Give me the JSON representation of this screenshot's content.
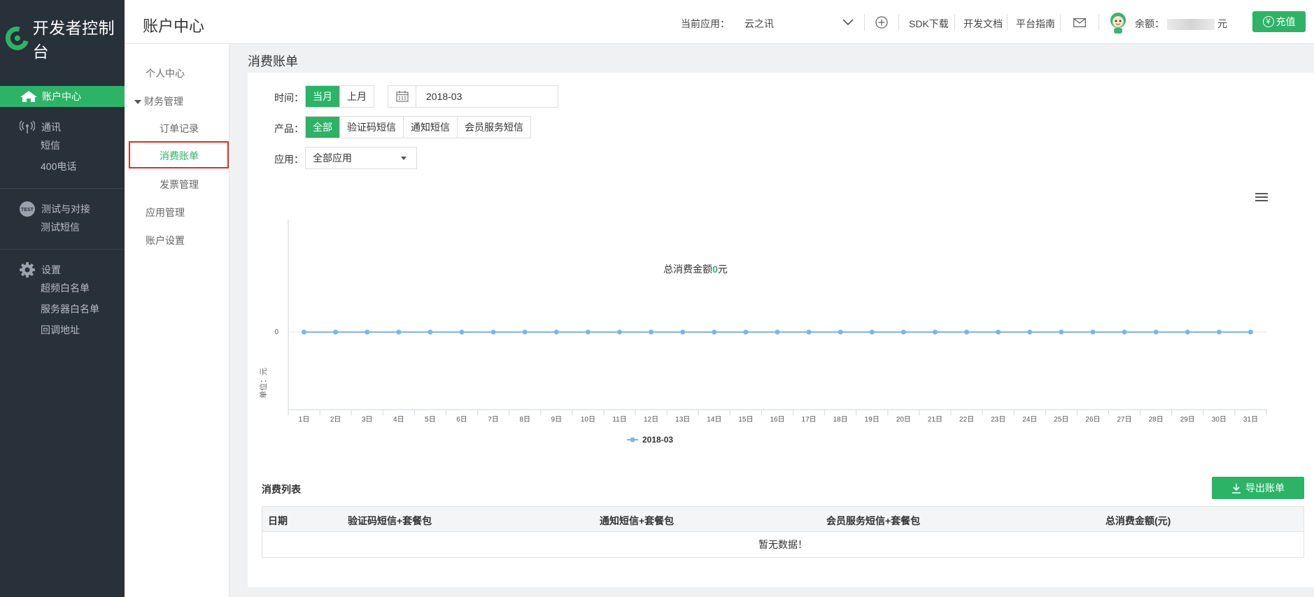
{
  "sidebar": {
    "logo_text": "开发者控制台",
    "active_item": "账户中心",
    "groups": [
      {
        "title": "通讯",
        "icon": "signal-icon",
        "items": [
          "短信",
          "400电话"
        ]
      },
      {
        "title": "测试与对接",
        "icon": "test-icon",
        "items": [
          "测试短信"
        ]
      },
      {
        "title": "设置",
        "icon": "gear-icon",
        "items": [
          "超频白名单",
          "服务器白名单",
          "回调地址"
        ]
      }
    ]
  },
  "topbar": {
    "title": "账户中心",
    "current_app_label": "当前应用：",
    "current_app_value": "云之讯",
    "sdk_download": "SDK下载",
    "dev_docs": "开发文档",
    "platform_guide": "平台指南",
    "balance_label": "余额：",
    "balance_unit": "元",
    "recharge": "充值"
  },
  "submenu": {
    "personal_center": "个人中心",
    "finance": "财务管理",
    "orders": "订单记录",
    "bills": "消费账单",
    "invoices": "发票管理",
    "app_manage": "应用管理",
    "account_settings": "账户设置"
  },
  "content": {
    "section_title": "消费账单",
    "time_label": "时间：",
    "time_options": [
      "当月",
      "上月"
    ],
    "date_value": "2018-03",
    "product_label": "产品：",
    "product_options": [
      "全部",
      "验证码短信",
      "通知短信",
      "会员服务短信"
    ],
    "app_label": "应用：",
    "app_select_value": "全部应用",
    "list_title": "消费列表",
    "export_button": "导出账单",
    "table": {
      "headers": [
        "日期",
        "验证码短信+套餐包",
        "通知短信+套餐包",
        "会员服务短信+套餐包",
        "总消费金额(元)"
      ],
      "empty_text": "暂无数据！"
    }
  },
  "chart_data": {
    "type": "line",
    "title_prefix": "总消费金额",
    "title_value": "0",
    "title_suffix": "元",
    "ylabel": "单位：元",
    "y_ticks": [
      "0"
    ],
    "categories": [
      "1日",
      "2日",
      "3日",
      "4日",
      "5日",
      "6日",
      "7日",
      "8日",
      "9日",
      "10日",
      "11日",
      "12日",
      "13日",
      "14日",
      "15日",
      "16日",
      "17日",
      "18日",
      "19日",
      "20日",
      "21日",
      "22日",
      "23日",
      "24日",
      "25日",
      "26日",
      "27日",
      "28日",
      "29日",
      "30日",
      "31日"
    ],
    "series": [
      {
        "name": "2018-03",
        "values": [
          0,
          0,
          0,
          0,
          0,
          0,
          0,
          0,
          0,
          0,
          0,
          0,
          0,
          0,
          0,
          0,
          0,
          0,
          0,
          0,
          0,
          0,
          0,
          0,
          0,
          0,
          0,
          0,
          0,
          0,
          0
        ]
      }
    ],
    "color": "#7cb5ec",
    "accent": "#2db366",
    "legend": "bottom-center"
  }
}
